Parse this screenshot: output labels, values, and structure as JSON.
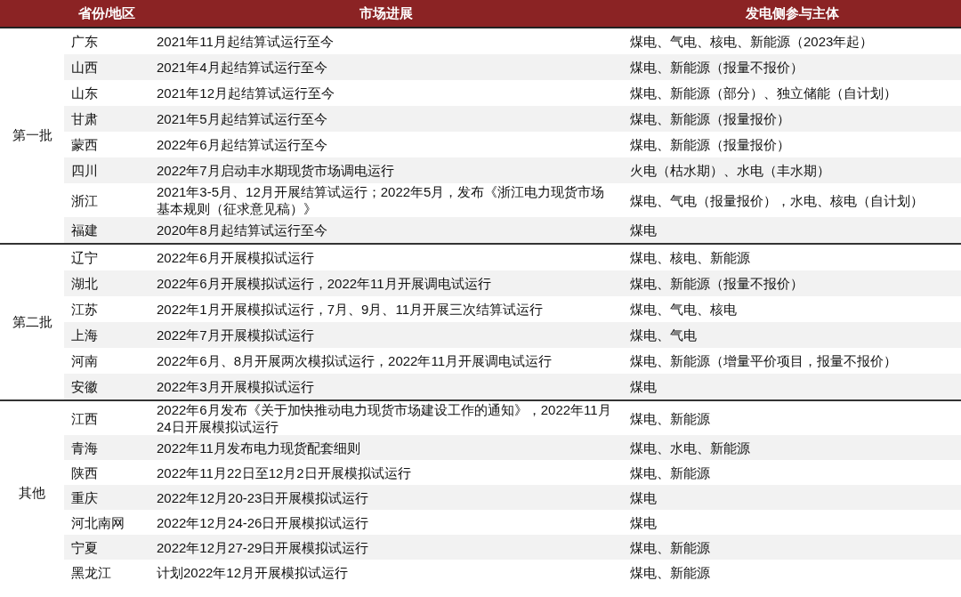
{
  "table": {
    "columns": [
      "省份/地区",
      "市场进展",
      "发电侧参与主体"
    ],
    "groups": [
      {
        "label": "第一批",
        "rows": [
          {
            "province": "广东",
            "progress": "2021年11月起结算试运行至今",
            "participants": "煤电、气电、核电、新能源（2023年起）"
          },
          {
            "province": "山西",
            "progress": "2021年4月起结算试运行至今",
            "participants": "煤电、新能源（报量不报价）"
          },
          {
            "province": "山东",
            "progress": "2021年12月起结算试运行至今",
            "participants": "煤电、新能源（部分）、独立储能（自计划）"
          },
          {
            "province": "甘肃",
            "progress": "2021年5月起结算试运行至今",
            "participants": "煤电、新能源（报量报价）"
          },
          {
            "province": "蒙西",
            "progress": "2022年6月起结算试运行至今",
            "participants": "煤电、新能源（报量报价）"
          },
          {
            "province": "四川",
            "progress": "2022年7月启动丰水期现货市场调电运行",
            "participants": "火电（枯水期）、水电（丰水期）"
          },
          {
            "province": "浙江",
            "progress": "2021年3-5月、12月开展结算试运行；2022年5月，发布《浙江电力现货市场基本规则（征求意见稿）》",
            "participants": "煤电、气电（报量报价），水电、核电（自计划）"
          },
          {
            "province": "福建",
            "progress": "2020年8月起结算试运行至今",
            "participants": "煤电"
          }
        ]
      },
      {
        "label": "第二批",
        "rows": [
          {
            "province": "辽宁",
            "progress": "2022年6月开展模拟试运行",
            "participants": "煤电、核电、新能源"
          },
          {
            "province": "湖北",
            "progress": "2022年6月开展模拟试运行，2022年11月开展调电试运行",
            "participants": "煤电、新能源（报量不报价）"
          },
          {
            "province": "江苏",
            "progress": "2022年1月开展模拟试运行，7月、9月、11月开展三次结算试运行",
            "participants": "煤电、气电、核电"
          },
          {
            "province": "上海",
            "progress": "2022年7月开展模拟试运行",
            "participants": "煤电、气电"
          },
          {
            "province": "河南",
            "progress": "2022年6月、8月开展两次模拟试运行，2022年11月开展调电试运行",
            "participants": "煤电、新能源（增量平价项目，报量不报价）"
          },
          {
            "province": "安徽",
            "progress": "2022年3月开展模拟试运行",
            "participants": "煤电"
          }
        ]
      },
      {
        "label": "其他",
        "rows": [
          {
            "province": "江西",
            "progress": "2022年6月发布《关于加快推动电力现货市场建设工作的通知》，2022年11月24日开展模拟试运行",
            "participants": "煤电、新能源"
          },
          {
            "province": "青海",
            "progress": "2022年11月发布电力现货配套细则",
            "participants": "煤电、水电、新能源"
          },
          {
            "province": "陕西",
            "progress": "2022年11月22日至12月2日开展模拟试运行",
            "participants": "煤电、新能源"
          },
          {
            "province": "重庆",
            "progress": "2022年12月20-23日开展模拟试运行",
            "participants": "煤电"
          },
          {
            "province": "河北南网",
            "progress": "2022年12月24-26日开展模拟试运行",
            "participants": "煤电"
          },
          {
            "province": "宁夏",
            "progress": "2022年12月27-29日开展模拟试运行",
            "participants": "煤电、新能源"
          },
          {
            "province": "黑龙江",
            "progress": "计划2022年12月开展模拟试运行",
            "participants": "煤电、新能源"
          }
        ]
      }
    ]
  }
}
